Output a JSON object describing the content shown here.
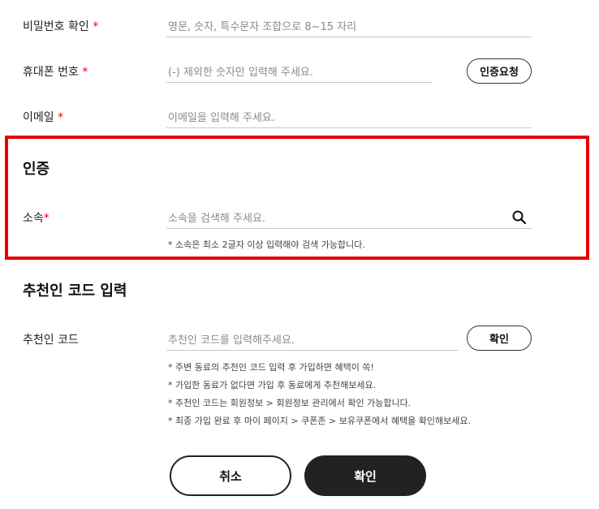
{
  "fields": {
    "password_confirm": {
      "label": "비밀번호 확인",
      "required": "*",
      "placeholder": "영문, 숫자, 특수문자 조합으로 8~15 자리"
    },
    "phone": {
      "label": "휴대폰 번호",
      "required": "*",
      "placeholder": "(-) 제외한 숫자만 입력해 주세요.",
      "button": "인증요청"
    },
    "email": {
      "label": "이메일",
      "required": "*",
      "placeholder": "이메일을 입력해 주세요."
    }
  },
  "auth_section": {
    "title": "인증",
    "affiliation": {
      "label": "소속",
      "required": "*",
      "placeholder": "소속을 검색해 주세요.",
      "icon": "search-icon",
      "note": "* 소속은 최소 2글자 이상 입력해야 검색 가능합니다."
    }
  },
  "referral_section": {
    "title": "추천인 코드 입력",
    "label": "추천인 코드",
    "placeholder": "추천인 코드를 입력해주세요.",
    "button": "확인",
    "notes": [
      "* 주변 동료의 추천인 코드 입력 후 가입하면 혜택이 쏙!",
      "* 가입한 동료가 없다면 가입 후 동료에게 추천해보세요.",
      "* 추천인 코드는 회원정보 > 회원정보 관리에서 확인 가능합니다.",
      "* 최종 가입 완료 후 마이 페이지 > 쿠폰존 > 보유쿠폰에서 혜택을 확인해보세요."
    ]
  },
  "actions": {
    "cancel": "취소",
    "confirm": "확인"
  },
  "colors": {
    "required": "#e60012",
    "highlight_frame": "#e60000",
    "primary_button": "#222222"
  }
}
